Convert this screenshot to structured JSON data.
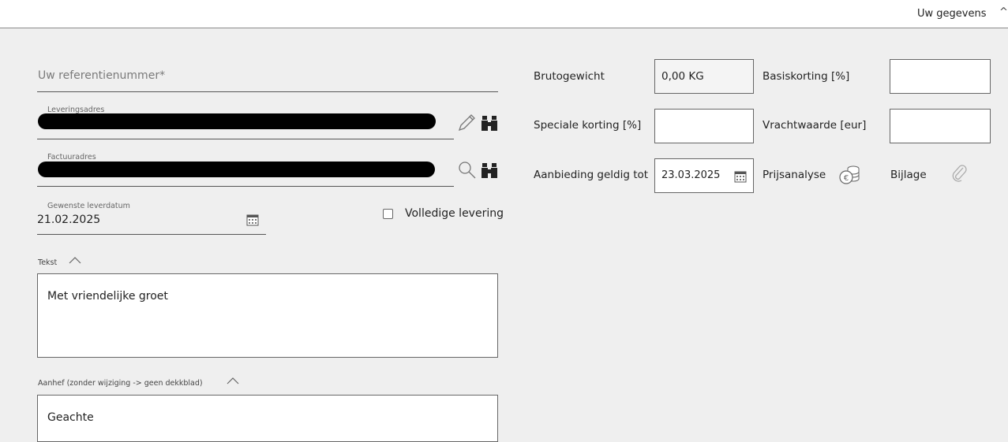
{
  "header": {
    "user_link": "Uw gegevens",
    "caret": "^"
  },
  "form": {
    "reference_placeholder": "Uw referentienummer*",
    "delivery_address_label": "Leveringsadres",
    "invoice_address_label": "Factuuradres",
    "desired_date_label": "Gewenste leverdatum",
    "desired_date_value": "21.02.2025",
    "full_delivery_label": "Volledige levering",
    "text_section_label": "Tekst",
    "text_value": "Met vriendelijke groet",
    "salutation_section_label": "Aanhef (zonder wijziging -> geen dekkblad)",
    "salutation_value": "Geachte"
  },
  "details": {
    "gross_weight_label": "Brutogewicht",
    "gross_weight_value": "0,00 KG",
    "base_discount_label": "Basiskorting [%]",
    "base_discount_value": "",
    "special_discount_label": "Speciale korting [%]",
    "special_discount_value": "",
    "freight_label": "Vrachtwaarde [eur]",
    "freight_value": "",
    "offer_valid_label": "Aanbieding geldig tot",
    "offer_valid_value": "23.03.2025",
    "price_analysis_label": "Prijsanalyse",
    "attachment_label": "Bijlage"
  }
}
